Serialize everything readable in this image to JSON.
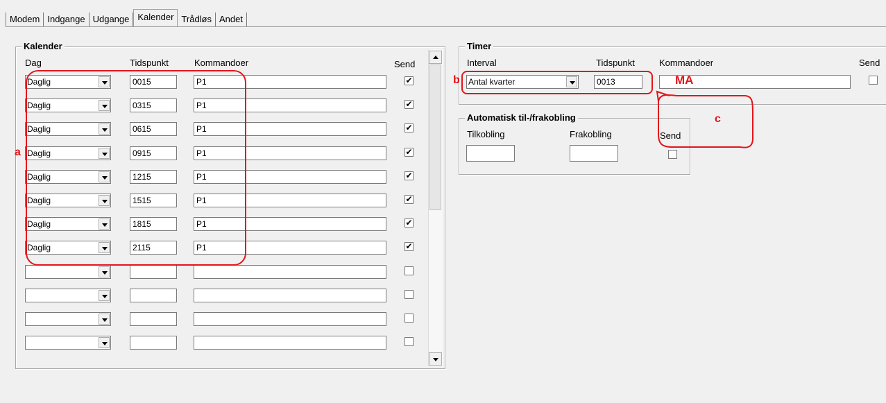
{
  "tabs": [
    "Modem",
    "Indgange",
    "Udgange",
    "Kalender",
    "Trådløs",
    "Andet"
  ],
  "kalender": {
    "title": "Kalender",
    "headers": {
      "dag": "Dag",
      "tidspunkt": "Tidspunkt",
      "kommandoer": "Kommandoer",
      "send": "Send"
    },
    "rows": [
      {
        "dag": "Daglig",
        "tidspunkt": "0015",
        "kommando": "P1",
        "send": true
      },
      {
        "dag": "Daglig",
        "tidspunkt": "0315",
        "kommando": "P1",
        "send": true
      },
      {
        "dag": "Daglig",
        "tidspunkt": "0615",
        "kommando": "P1",
        "send": true
      },
      {
        "dag": "Daglig",
        "tidspunkt": "0915",
        "kommando": "P1",
        "send": true
      },
      {
        "dag": "Daglig",
        "tidspunkt": "1215",
        "kommando": "P1",
        "send": true
      },
      {
        "dag": "Daglig",
        "tidspunkt": "1515",
        "kommando": "P1",
        "send": true
      },
      {
        "dag": "Daglig",
        "tidspunkt": "1815",
        "kommando": "P1",
        "send": true
      },
      {
        "dag": "Daglig",
        "tidspunkt": "2115",
        "kommando": "P1",
        "send": true
      },
      {
        "dag": "",
        "tidspunkt": "",
        "kommando": "",
        "send": false
      },
      {
        "dag": "",
        "tidspunkt": "",
        "kommando": "",
        "send": false
      },
      {
        "dag": "",
        "tidspunkt": "",
        "kommando": "",
        "send": false
      },
      {
        "dag": "",
        "tidspunkt": "",
        "kommando": "",
        "send": false
      }
    ]
  },
  "timer": {
    "title": "Timer",
    "headers": {
      "interval": "Interval",
      "tidspunkt": "Tidspunkt",
      "kommandoer": "Kommandoer",
      "send": "Send"
    },
    "interval": "Antal kvarter",
    "tidspunkt": "0013",
    "kommando": "",
    "send": false
  },
  "auto": {
    "title": "Automatisk til-/frakobling",
    "headers": {
      "tilkobling": "Tilkobling",
      "frakobling": "Frakobling",
      "send": "Send"
    },
    "tilkobling": "",
    "frakobling": "",
    "send": false
  },
  "annotations": {
    "a": "a",
    "b": "b",
    "c": "c",
    "ma": "MA"
  },
  "colors": {
    "annotation": "#e3151a",
    "background": "#f0f0f0"
  }
}
